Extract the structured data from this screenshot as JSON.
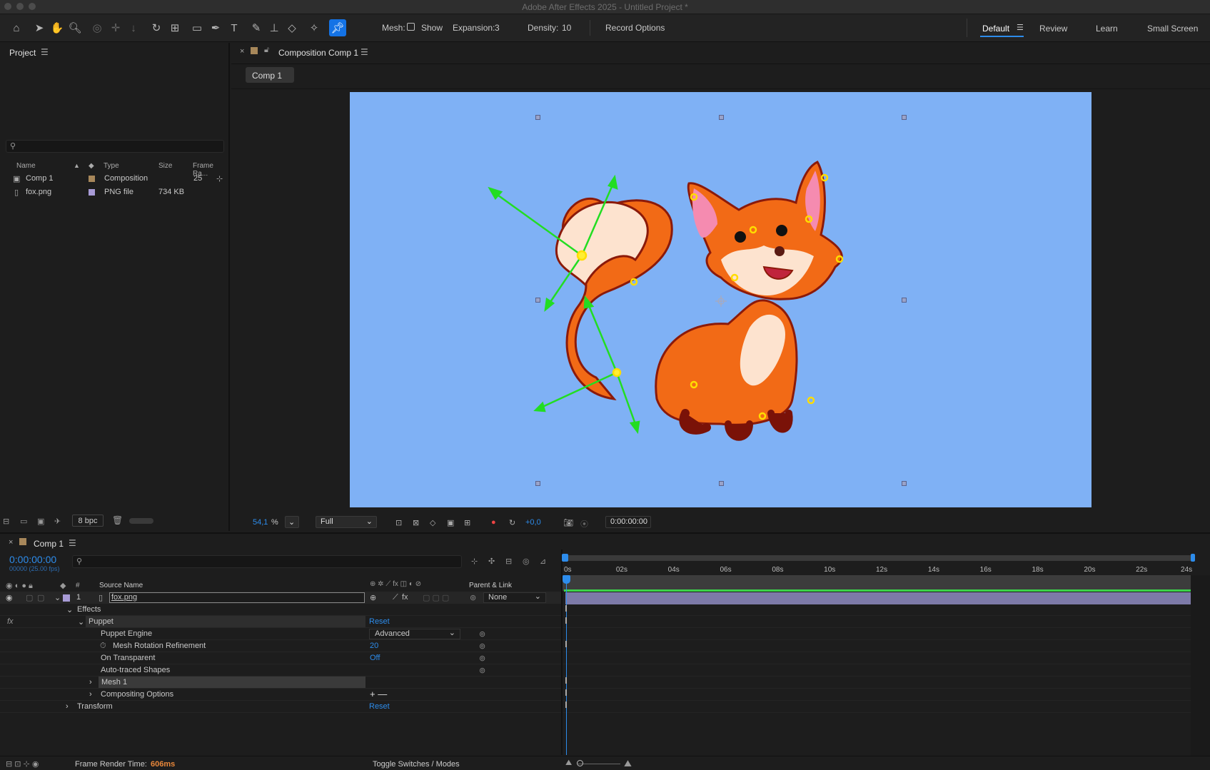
{
  "window": {
    "title": "Adobe After Effects 2025 - Untitled Project *"
  },
  "toolbar": {
    "mesh_label": "Mesh:",
    "show_label": "Show",
    "expansion_label": "Expansion:",
    "expansion_value": "3",
    "density_label": "Density:",
    "density_value": "10",
    "record_options": "Record Options",
    "tools": [
      "home-icon",
      "selection-tool-icon",
      "hand-tool-icon",
      "zoom-tool-icon",
      "orbit-camera-icon",
      "pan-camera-icon",
      "dolly-camera-icon",
      "rotation-tool-icon",
      "pan-behind-icon",
      "rectangle-tool-icon",
      "pen-tool-icon",
      "type-tool-icon",
      "brush-tool-icon",
      "clone-stamp-icon",
      "eraser-tool-icon",
      "roto-brush-icon",
      "puppet-pin-icon"
    ]
  },
  "workspaces": [
    {
      "label": "Default",
      "active": true
    },
    {
      "label": "Review",
      "active": false
    },
    {
      "label": "Learn",
      "active": false
    },
    {
      "label": "Small Screen",
      "active": false
    }
  ],
  "project": {
    "title": "Project",
    "columns": {
      "name": "Name",
      "type": "Type",
      "size": "Size",
      "frame_rate": "Frame Ra..."
    },
    "items": [
      {
        "name": "Comp 1",
        "type": "Composition",
        "size": "",
        "frame_rate": "25",
        "color": "#a7875a"
      },
      {
        "name": "fox.png",
        "type": "PNG file",
        "size": "734 KB",
        "frame_rate": "",
        "color": "#a89bd6"
      }
    ],
    "bpc": "8 bpc"
  },
  "viewer": {
    "tab_title": "Composition Comp 1",
    "crumb": "Comp 1",
    "zoom": "54,1",
    "zoom_unit": "%",
    "resolution": "Full",
    "exposure": "+0,0",
    "timecode": "0:00:00:00",
    "background_color": "#7fb1f5"
  },
  "timeline": {
    "tab_title": "Comp 1",
    "timecode": "0:00:00:00",
    "frames_fps": "00000 (25.00 fps)",
    "headers": {
      "num": "#",
      "source_name": "Source Name",
      "parent_link": "Parent & Link"
    },
    "layer": {
      "index": "1",
      "name": "fox.png",
      "parent": "None"
    },
    "ruler": [
      "0s",
      "02s",
      "04s",
      "06s",
      "08s",
      "10s",
      "12s",
      "14s",
      "16s",
      "18s",
      "20s",
      "22s",
      "24s"
    ],
    "properties": {
      "effects": "Effects",
      "puppet": "Puppet",
      "puppet_reset": "Reset",
      "puppet_engine_label": "Puppet Engine",
      "puppet_engine_value": "Advanced",
      "mesh_rotation_label": "Mesh Rotation Refinement",
      "mesh_rotation_value": "20",
      "on_transparent_label": "On Transparent",
      "on_transparent_value": "Off",
      "auto_traced_label": "Auto-traced Shapes",
      "mesh_label": "Mesh 1",
      "compositing_label": "Compositing Options",
      "compositing_value": "+ —",
      "transform_label": "Transform",
      "transform_reset": "Reset"
    },
    "footer": {
      "render_label": "Frame Render Time:",
      "render_value": "606ms",
      "toggle": "Toggle Switches / Modes"
    }
  }
}
